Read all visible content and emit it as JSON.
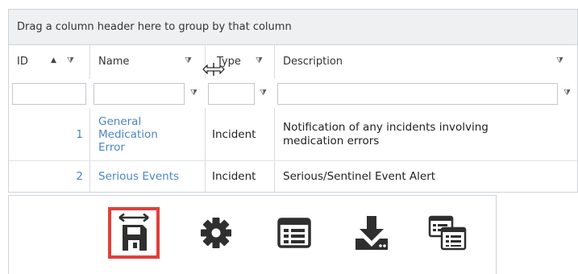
{
  "grid": {
    "group_panel_text": "Drag a column header here to group by that column",
    "columns": [
      {
        "label": "ID",
        "sort": "ascending"
      },
      {
        "label": "Name"
      },
      {
        "label": "Type"
      },
      {
        "label": "Description"
      }
    ],
    "filter_icon": "funnel-icon",
    "rows": [
      {
        "id": "1",
        "name": "General Medication Error",
        "type": "Incident",
        "description": "Notification of any incidents involving medication errors"
      },
      {
        "id": "2",
        "name": "Serious Events",
        "type": "Incident",
        "description": "Serious/Sentinel Event Alert"
      }
    ],
    "cursor": "column-resize-cursor"
  },
  "toolbar": {
    "items": [
      {
        "icon": "save-column-width-icon",
        "selected": true
      },
      {
        "icon": "gear-icon",
        "selected": false
      },
      {
        "icon": "grid-layout-icon",
        "selected": false
      },
      {
        "icon": "download-icon",
        "selected": false
      },
      {
        "icon": "multi-grid-icon",
        "selected": false
      }
    ],
    "highlight_color": "#e0403a",
    "icon_color": "#2f2f2f"
  },
  "colors": {
    "link": "#4a86c5",
    "border": "#cfd3d8",
    "group_panel_bg": "#eef0f2"
  }
}
